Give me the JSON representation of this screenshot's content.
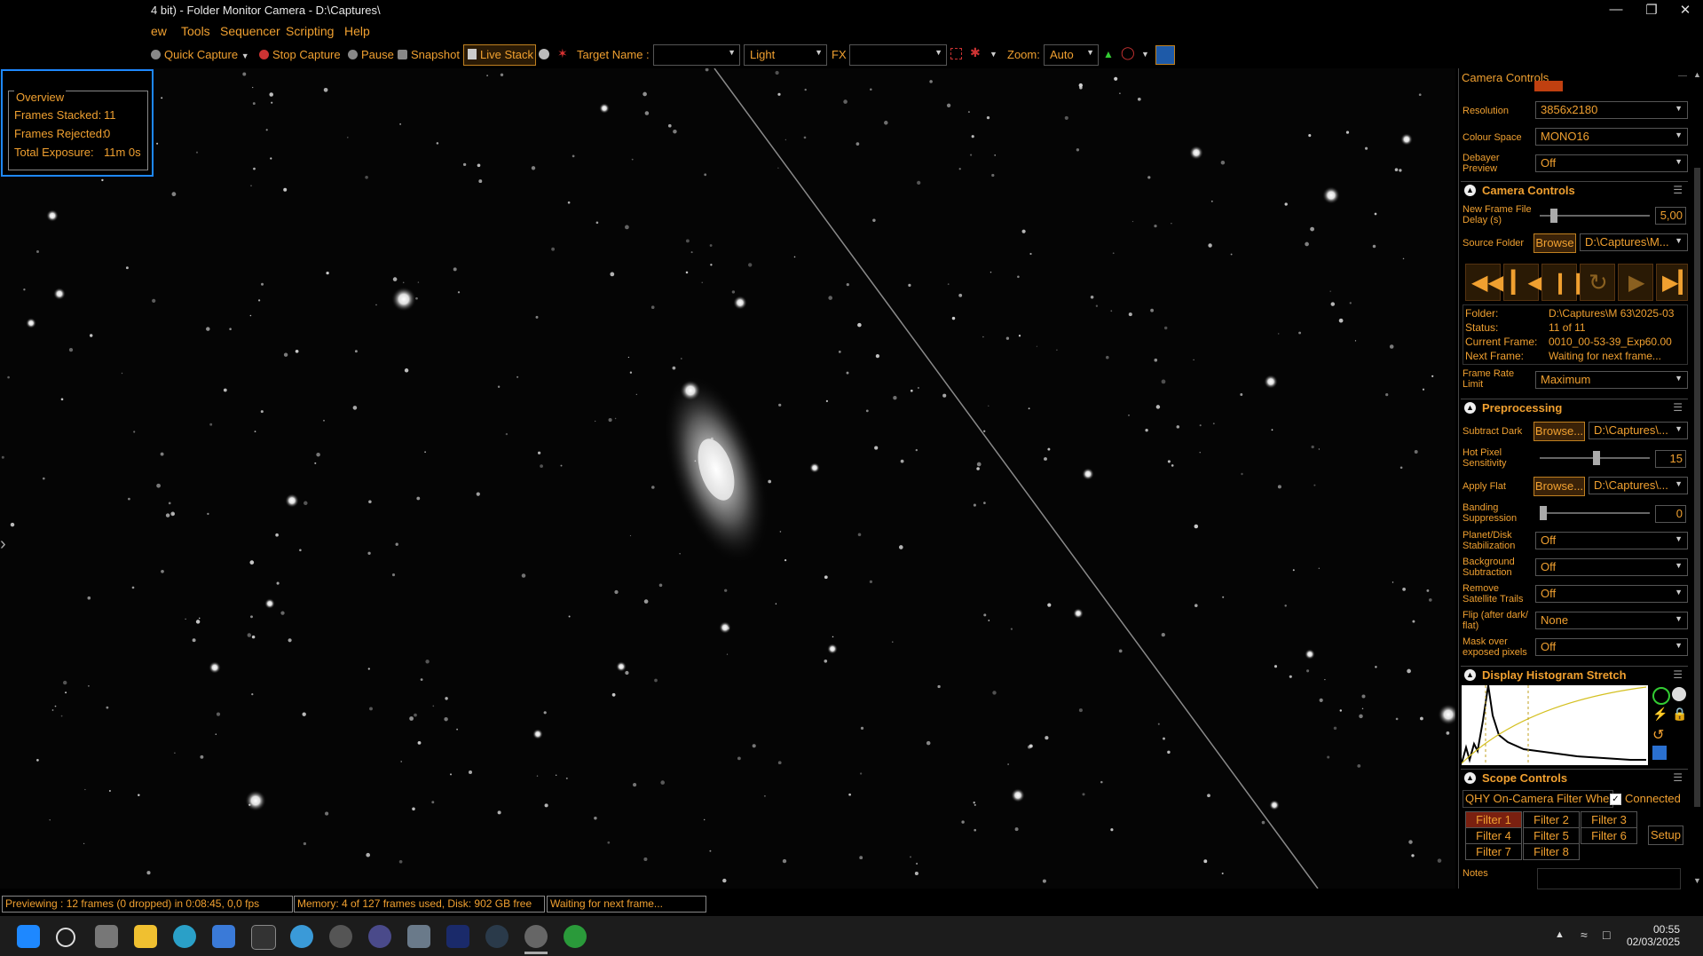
{
  "window": {
    "title": "4 bit) - Folder Monitor Camera - D:\\Captures\\",
    "minimize_icon": "minimize-icon",
    "restore_icon": "restore-icon",
    "close_icon": "close-icon"
  },
  "menu": {
    "items": [
      "ew",
      "Tools",
      "Sequencer",
      "Scripting",
      "Help"
    ]
  },
  "toolbar": {
    "quick_capture": "Quick Capture",
    "stop_capture": "Stop Capture",
    "pause": "Pause",
    "snapshot": "Snapshot",
    "live_stack": "Live Stack",
    "target_name_label": "Target Name :",
    "target_name_value": "",
    "frame_type": "Light",
    "fx_label": "FX",
    "fx_value": "",
    "zoom_label": "Zoom:",
    "zoom_value": "Auto"
  },
  "overview": {
    "header": "Overview",
    "frames_stacked_label": "Frames Stacked:",
    "frames_stacked_value": "11",
    "frames_rejected_label": "Frames Rejected:",
    "frames_rejected_value": "0",
    "total_exposure_label": "Total Exposure:",
    "total_exposure_value": "11m 0s"
  },
  "panel": {
    "header": "Camera Controls",
    "resolution_label": "Resolution",
    "resolution_value": "3856x2180",
    "colour_space_label": "Colour Space",
    "colour_space_value": "MONO16",
    "debayer_label": "Debayer Preview",
    "debayer_value": "Off",
    "camera_controls": {
      "title": "Camera Controls",
      "new_frame_delay_label": "New Frame File Delay (s)",
      "new_frame_delay_value": "5,00",
      "source_folder_label": "Source Folder",
      "browse": "Browse",
      "source_folder_value": "D:\\Captures\\M...",
      "folder_label": "Folder:",
      "folder_value": "D:\\Captures\\M 63\\2025-03",
      "status_label": "Status:",
      "status_value": "11 of 11",
      "current_frame_label": "Current Frame:",
      "current_frame_value": "0010_00-53-39_Exp60.00",
      "next_frame_label": "Next Frame:",
      "next_frame_value": "Waiting for next frame...",
      "frame_rate_label": "Frame Rate Limit",
      "frame_rate_value": "Maximum"
    },
    "preprocessing": {
      "title": "Preprocessing",
      "subtract_dark_label": "Subtract Dark",
      "subtract_dark_browse": "Browse...",
      "subtract_dark_value": "D:\\Captures\\...",
      "hot_pixel_label": "Hot Pixel Sensitivity",
      "hot_pixel_value": "15",
      "apply_flat_label": "Apply Flat",
      "apply_flat_browse": "Browse...",
      "apply_flat_value": "D:\\Captures\\...",
      "banding_label": "Banding Suppression",
      "banding_value": "0",
      "planet_label": "Planet/Disk Stabilization",
      "planet_value": "Off",
      "background_label": "Background Subtraction",
      "background_value": "Off",
      "satellite_label": "Remove Satellite Trails",
      "satellite_value": "Off",
      "flip_label": "Flip (after dark/ flat)",
      "flip_value": "None",
      "mask_label": "Mask over exposed pixels",
      "mask_value": "Off"
    },
    "histogram": {
      "title": "Display Histogram Stretch"
    },
    "scope": {
      "title": "Scope Controls",
      "device_label": "QHY On-Camera Filter Whe",
      "connected_label": "Connected",
      "filters": [
        "Filter 1",
        "Filter 2",
        "Filter 3",
        "Filter 4",
        "Filter 5",
        "Filter 6",
        "Filter 7",
        "Filter 8"
      ],
      "setup": "Setup",
      "notes_label": "Notes"
    }
  },
  "statusbar": {
    "preview": "Previewing : 12 frames (0 dropped) in 0:08:45, 0,0 fps",
    "memory": "Memory: 4 of 127 frames used, Disk: 902 GB free",
    "waiting": "Waiting for next frame..."
  },
  "taskbar": {
    "time": "00:55",
    "date": "02/03/2025"
  },
  "colors": {
    "accent": "#f0a030",
    "overview_border": "#1e88ff",
    "selected_filter": "#7a2010"
  }
}
